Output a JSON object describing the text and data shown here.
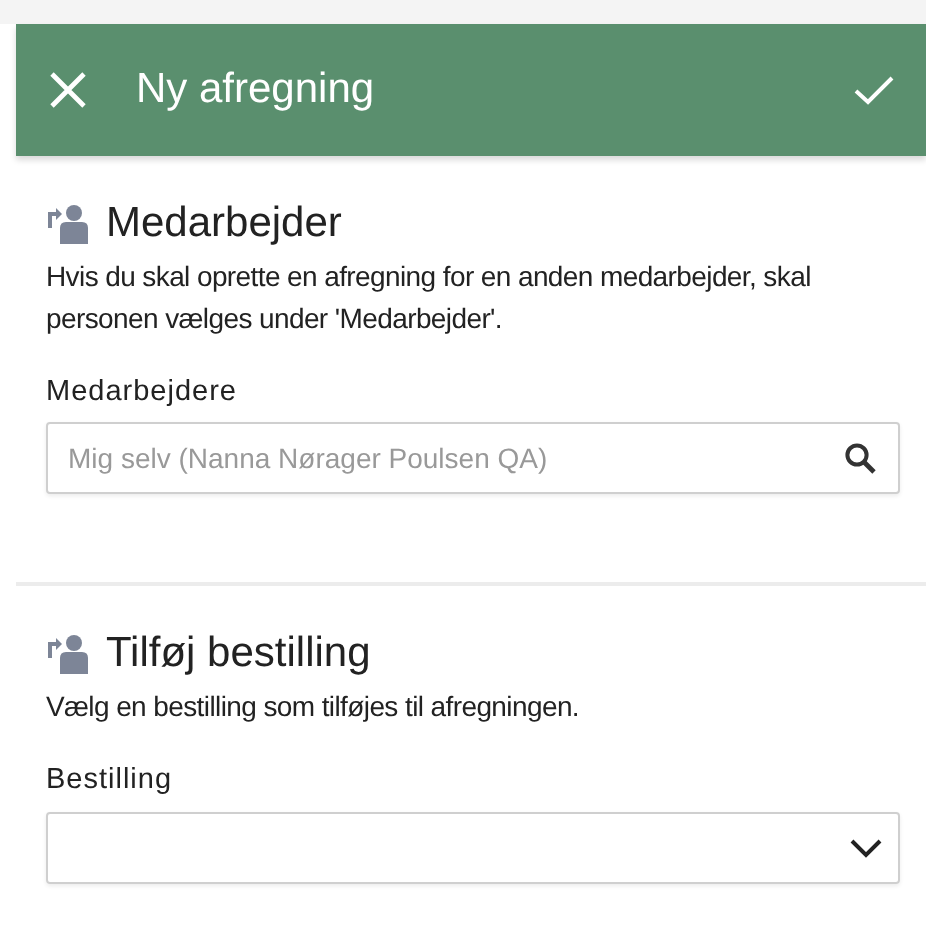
{
  "header": {
    "title": "Ny afregning"
  },
  "sections": [
    {
      "title": "Medarbejder",
      "description": "Hvis du skal oprette en afregning for en anden medarbejder, skal personen vælges under 'Medarbejder'.",
      "field": {
        "kind": "search",
        "label": "Medarbejdere",
        "placeholder": "Mig selv (Nanna Nørager Poulsen QA)"
      }
    },
    {
      "title": "Tilføj bestilling",
      "description": "Vælg en bestilling som tilføjes til afregningen.",
      "field": {
        "kind": "select",
        "label": "Bestilling"
      }
    }
  ]
}
